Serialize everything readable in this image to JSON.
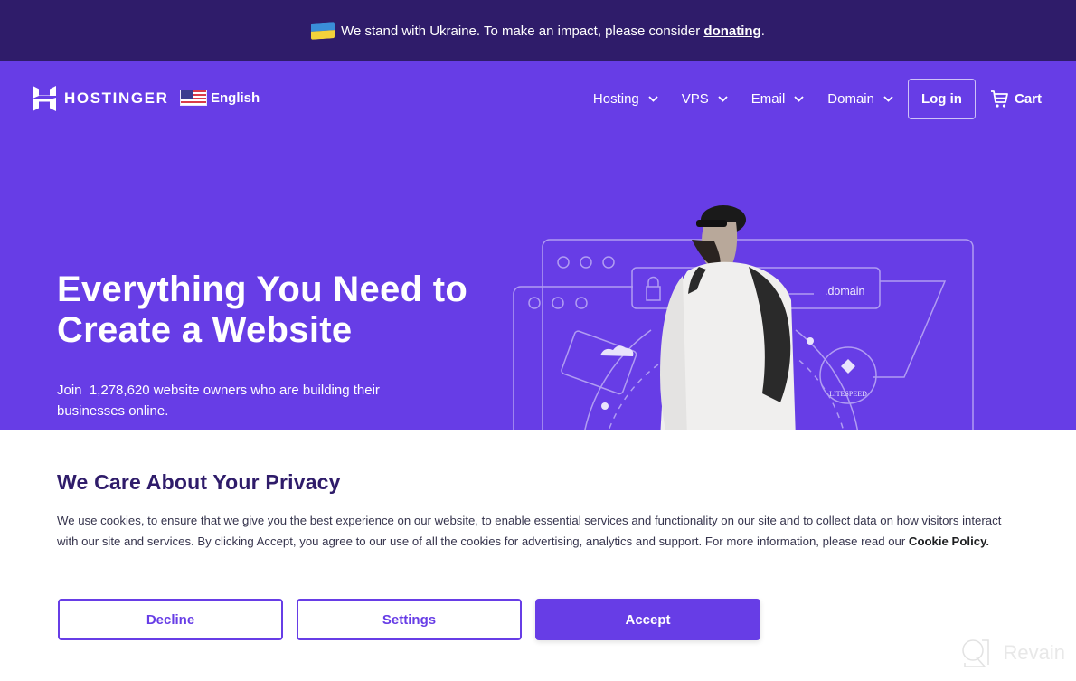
{
  "banner": {
    "text": "We stand with Ukraine. To make an impact, please consider ",
    "link": "donating",
    "suffix": ".",
    "flag_icon": "ukraine-flag-icon"
  },
  "nav": {
    "brand": "HOSTINGER",
    "language": "English",
    "menu": [
      {
        "label": "Hosting"
      },
      {
        "label": "VPS"
      },
      {
        "label": "Email"
      },
      {
        "label": "Domain"
      }
    ],
    "login": "Log in",
    "cart": "Cart"
  },
  "hero": {
    "headline_line1": "Everything You Need to",
    "headline_line2": "Create a Website",
    "sub_prefix": "Join ",
    "user_count": "1,278,620",
    "sub_suffix": " website owners who are building their businesses online.",
    "illustration": {
      "domain_label": ".domain",
      "badge_label": "LITESPEED"
    }
  },
  "cookie": {
    "title": "We Care About Your Privacy",
    "body": "We use cookies, to ensure that we give you the best experience on our website, to enable essential services and functionality on our site and to collect data on how visitors interact with our site and services. By clicking Accept, you agree to our use of all the cookies for advertising, analytics and support. For more information, please read our ",
    "policy_link": "Cookie Policy.",
    "buttons": {
      "decline": "Decline",
      "settings": "Settings",
      "accept": "Accept"
    }
  },
  "watermark": "Revain",
  "colors": {
    "banner_bg": "#2f1c6a",
    "brand_purple": "#673de6",
    "title_dark": "#2f1c6a"
  }
}
